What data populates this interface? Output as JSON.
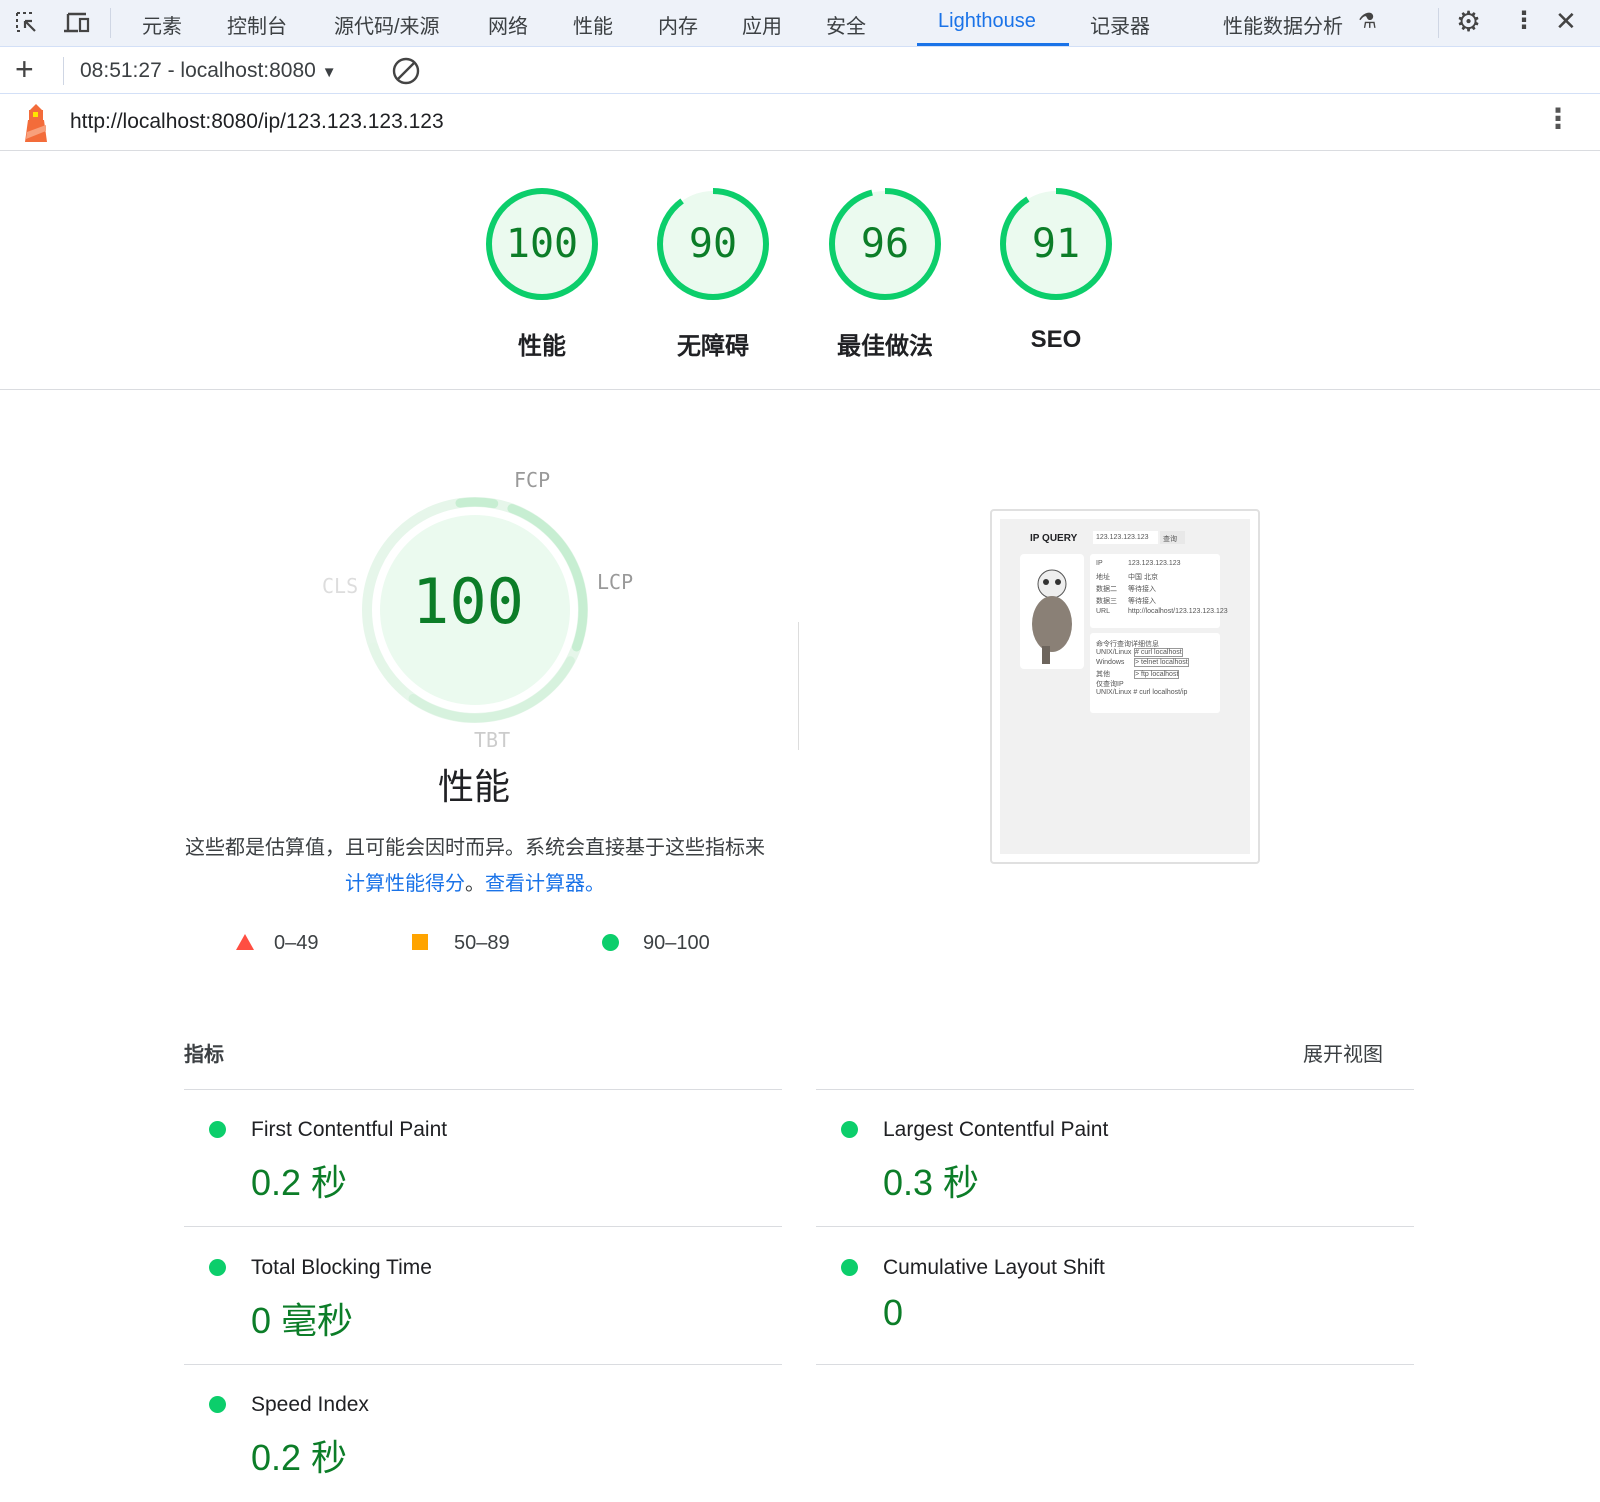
{
  "tabs": [
    "元素",
    "控制台",
    "源代码/来源",
    "网络",
    "性能",
    "内存",
    "应用",
    "安全",
    "Lighthouse",
    "记录器",
    "性能数据分析"
  ],
  "active_tab": "Lighthouse",
  "report_selector": "08:51:27 - localhost:8080",
  "url": "http://localhost:8080/ip/123.123.123.123",
  "scores": [
    {
      "value": 100,
      "label": "性能"
    },
    {
      "value": 90,
      "label": "无障碍"
    },
    {
      "value": 96,
      "label": "最佳做法"
    },
    {
      "value": 91,
      "label": "SEO"
    }
  ],
  "perf": {
    "score": "100",
    "title": "性能",
    "metric_labels": {
      "fcp": "FCP",
      "lcp": "LCP",
      "tbt": "TBT",
      "cls": "CLS"
    },
    "desc": "这些都是估算值，且可能会因时而异。系统会直接基于这些指标来",
    "link1": "计算性能得分",
    "sep": "。",
    "link2": "查看计算器。"
  },
  "legend": [
    "0–49",
    "50–89",
    "90–100"
  ],
  "colors": {
    "pass": "#0cce6b",
    "average": "#ffa400",
    "fail": "#ff4e42",
    "accent": "#1a73e8"
  },
  "metrics_header": "指标",
  "expand_view": "展开视图",
  "metrics": [
    {
      "name": "First Contentful Paint",
      "value": "0.2 秒"
    },
    {
      "name": "Largest Contentful Paint",
      "value": "0.3 秒"
    },
    {
      "name": "Total Blocking Time",
      "value": "0 毫秒"
    },
    {
      "name": "Cumulative Layout Shift",
      "value": "0"
    },
    {
      "name": "Speed Index",
      "value": "0.2 秒"
    }
  ],
  "thumbnail": {
    "title": "IP QUERY",
    "input": "123.123.123.123",
    "button": "查询",
    "rows": [
      [
        "IP",
        "123.123.123.123"
      ],
      [
        "地址",
        "中国 北京"
      ],
      [
        "数据二",
        "等待接入"
      ],
      [
        "数据三",
        "等待接入"
      ],
      [
        "URL",
        "http://localhost/123.123.123.123"
      ]
    ],
    "cmd_title": "命令行查询详细信息",
    "cmds": [
      [
        "UNIX/Linux",
        "# curl localhost"
      ],
      [
        "Windows",
        "> telnet localhost"
      ],
      [
        "其他",
        "> ftp localhost"
      ]
    ],
    "ip_only": "仅查询IP",
    "ip_cmd": [
      "UNIX/Linux",
      "# curl localhost/ip"
    ]
  }
}
